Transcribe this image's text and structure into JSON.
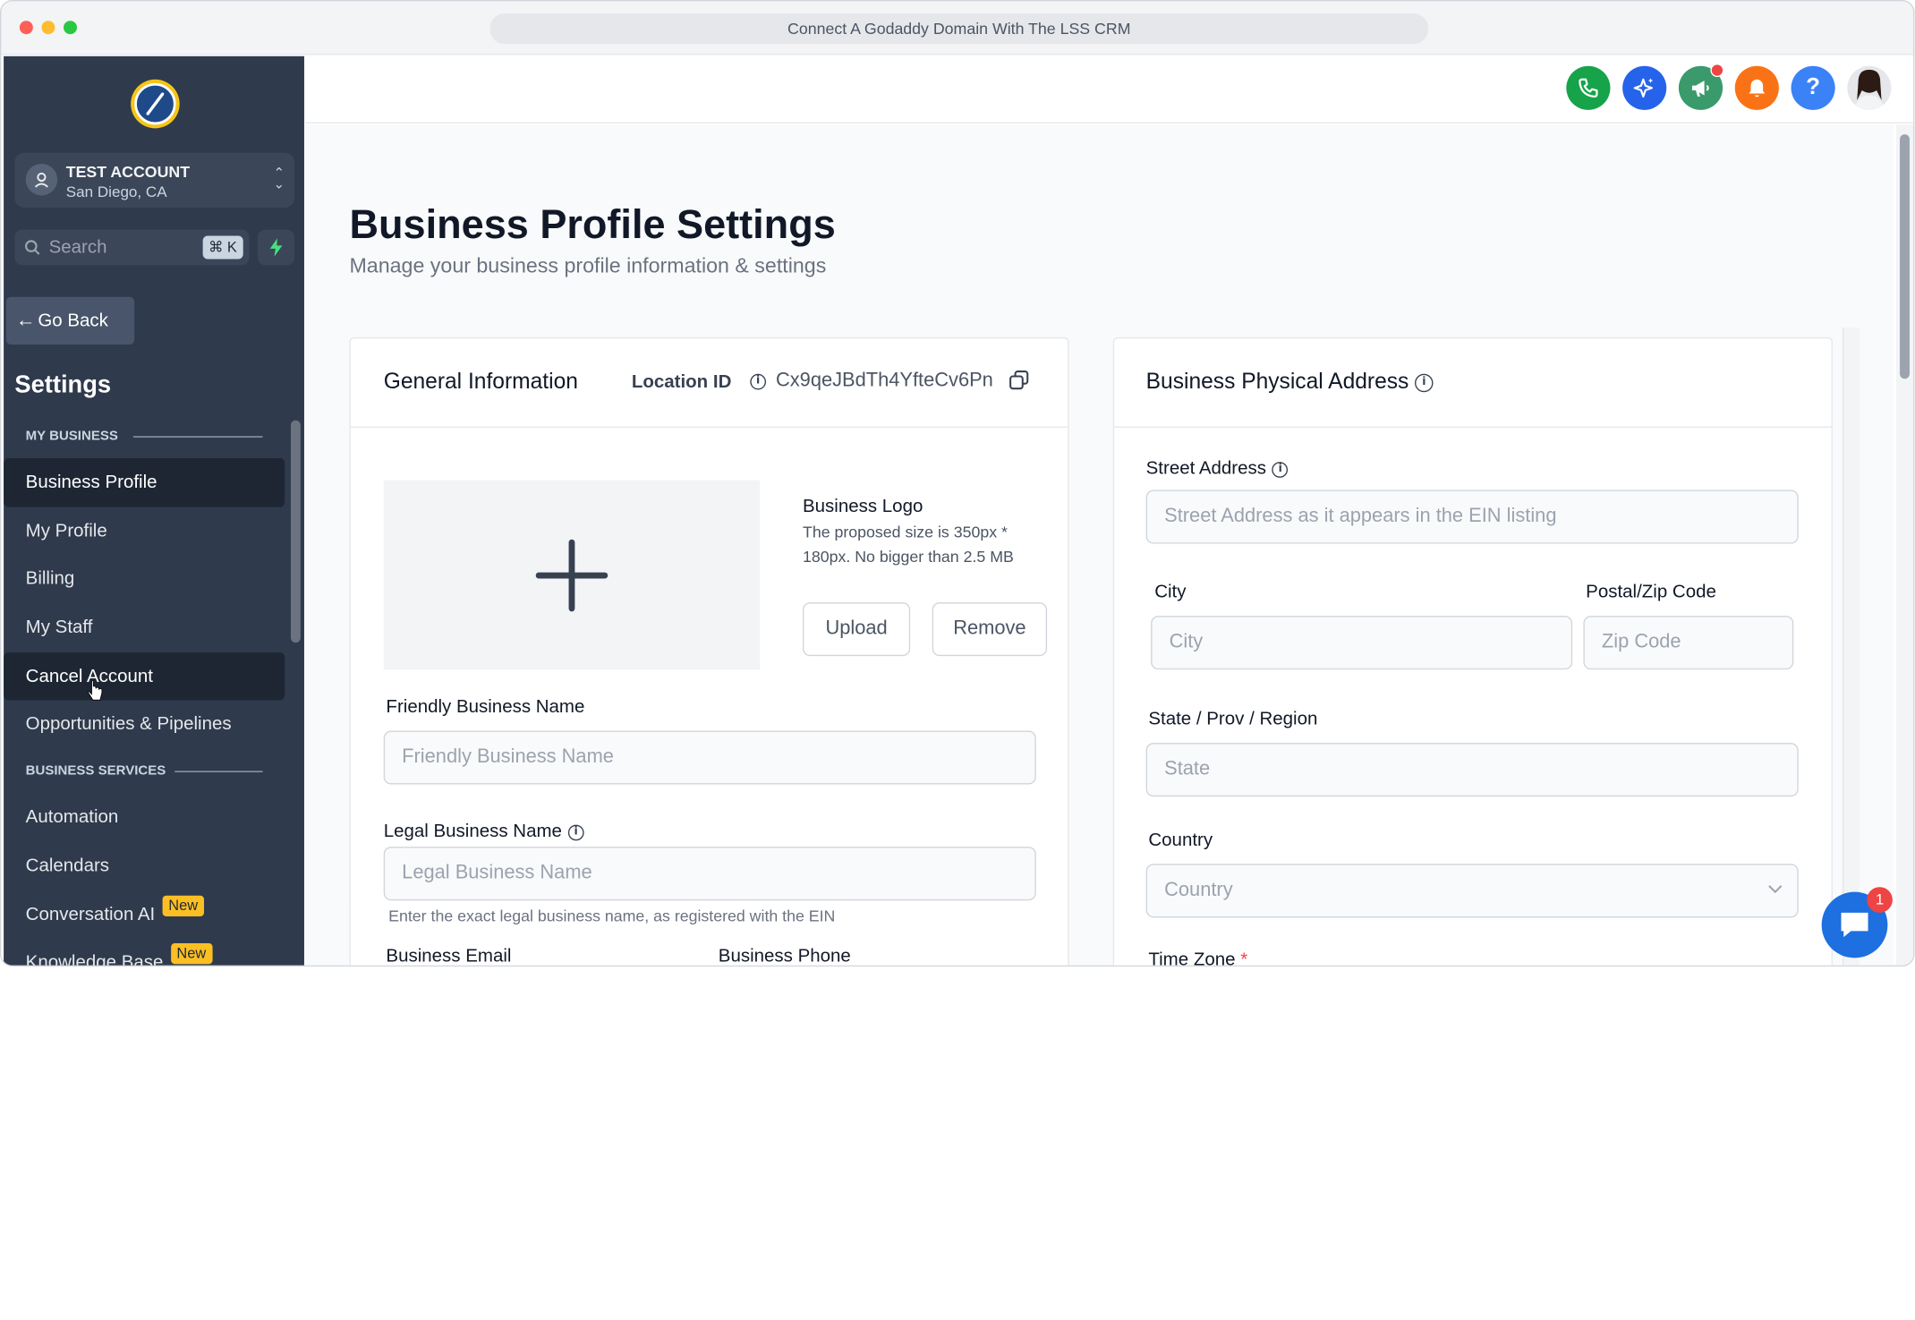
{
  "window": {
    "title": "Connect A Godaddy Domain With The LSS CRM"
  },
  "sidebar": {
    "account": {
      "name": "TEST ACCOUNT",
      "location": "San Diego, CA"
    },
    "search": {
      "placeholder": "Search",
      "shortcut": "⌘ K"
    },
    "go_back": "Go Back",
    "heading": "Settings",
    "sections": [
      {
        "title": "MY BUSINESS",
        "items": [
          "Business Profile",
          "My Profile",
          "Billing",
          "My Staff",
          "Cancel Account",
          "Opportunities & Pipelines"
        ]
      },
      {
        "title": "BUSINESS SERVICES",
        "items": [
          "Automation",
          "Calendars",
          "Conversation AI",
          "Knowledge Base"
        ]
      }
    ],
    "new_badge": "New"
  },
  "topbar": {
    "notification_dot_color": "#ef4444",
    "icons": [
      "phone-icon",
      "sparkle-icon",
      "megaphone-icon",
      "bell-icon",
      "help-icon",
      "avatar"
    ],
    "help_glyph": "?"
  },
  "page": {
    "title": "Business Profile Settings",
    "subtitle": "Manage your business profile information & settings"
  },
  "general": {
    "title": "General Information",
    "location_id_label": "Location ID",
    "location_id": "Cx9qeJBdTh4YfteCv6Pn",
    "logo_title": "Business Logo",
    "logo_hint_1": "The proposed size is 350px *",
    "logo_hint_2": "180px. No bigger than 2.5 MB",
    "upload": "Upload",
    "remove": "Remove",
    "friendly_label": "Friendly Business Name",
    "friendly_placeholder": "Friendly Business Name",
    "legal_label": "Legal Business Name",
    "legal_placeholder": "Legal Business Name",
    "legal_hint": "Enter the exact legal business name, as registered with the EIN",
    "email_label": "Business Email",
    "phone_label": "Business Phone"
  },
  "address": {
    "title": "Business Physical Address",
    "street_label": "Street Address",
    "street_placeholder": "Street Address as it appears in the EIN listing",
    "city_label": "City",
    "city_placeholder": "City",
    "zip_label": "Postal/Zip Code",
    "zip_placeholder": "Zip Code",
    "state_label": "State / Prov / Region",
    "state_placeholder": "State",
    "country_label": "Country",
    "country_placeholder": "Country",
    "tz_label": "Time Zone",
    "required_mark": "*"
  },
  "chat": {
    "badge": "1"
  }
}
